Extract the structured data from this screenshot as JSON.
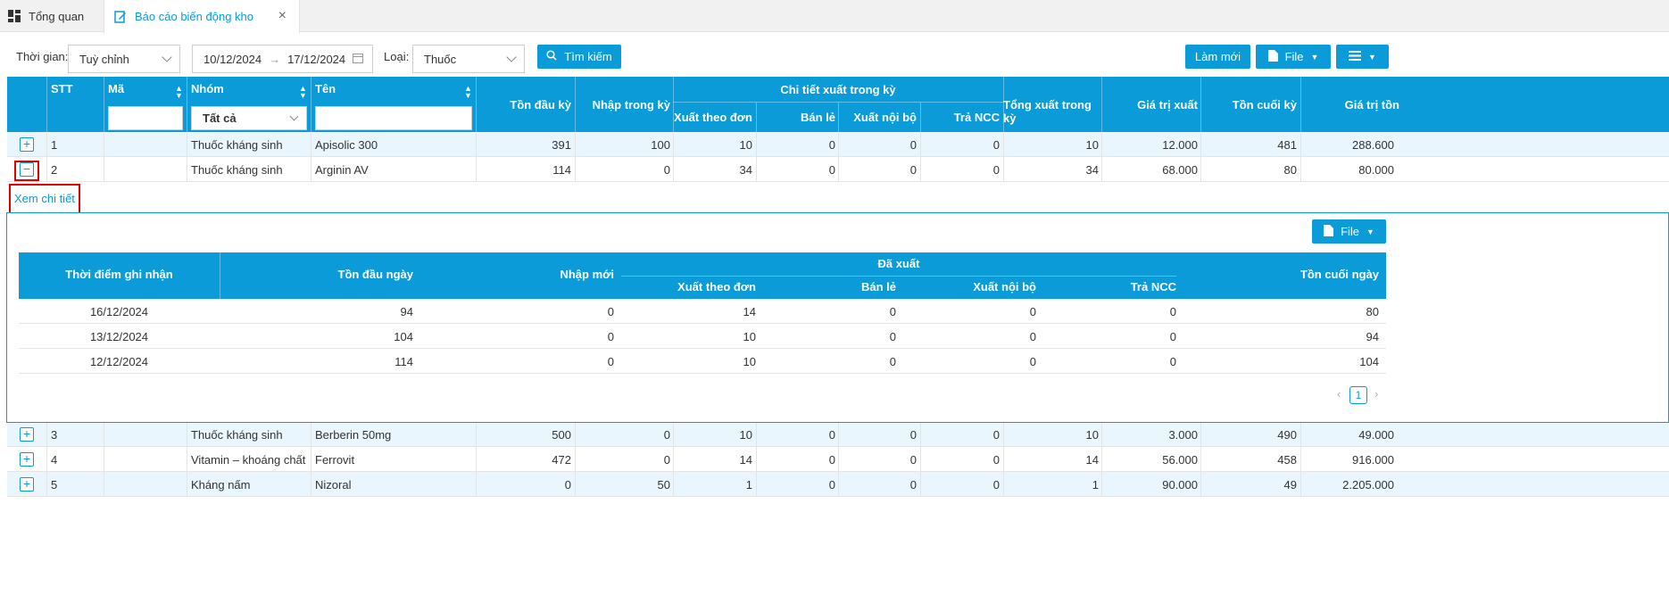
{
  "tabs": {
    "overview": "Tổng quan",
    "report": "Báo cáo biến động kho"
  },
  "filters": {
    "time_label": "Thời gian",
    "time_value": "Tuỳ chỉnh",
    "date_from": "10/12/2024",
    "date_to": "17/12/2024",
    "type_label": "Loại",
    "type_value": "Thuốc",
    "search_button": "Tìm kiếm",
    "refresh_button": "Làm mới",
    "file_button": "File"
  },
  "grid": {
    "headers": {
      "stt": "STT",
      "ma": "Mã",
      "nhom": "Nhóm",
      "ten": "Tên",
      "ton_dau": "Tồn đầu kỳ",
      "nhap": "Nhập trong kỳ",
      "chi_tiet": "Chi tiết xuất trong kỳ",
      "xuat_don": "Xuất theo đơn",
      "ban_le": "Bán lẻ",
      "xuat_noi_bo": "Xuất nội bộ",
      "tra_ncc": "Trả NCC",
      "tong_xuat": "Tổng xuất trong kỳ",
      "gia_tri_xuat": "Giá trị xuất",
      "ton_cuoi": "Tồn cuối kỳ",
      "gia_tri_ton": "Giá trị tồn"
    },
    "group_filter": "Tất cả",
    "rows": [
      {
        "stt": "1",
        "nhom": "Thuốc kháng sinh",
        "ten": "Apisolic 300",
        "ton_dau": "391",
        "nhap": "100",
        "xuat_don": "10",
        "ban_le": "0",
        "xuat_noi_bo": "0",
        "tra_ncc": "0",
        "tong_xuat": "10",
        "gia_tri_xuat": "12.000",
        "ton_cuoi": "481",
        "gia_tri_ton": "288.600"
      },
      {
        "stt": "2",
        "nhom": "Thuốc kháng sinh",
        "ten": "Arginin AV",
        "ton_dau": "114",
        "nhap": "0",
        "xuat_don": "34",
        "ban_le": "0",
        "xuat_noi_bo": "0",
        "tra_ncc": "0",
        "tong_xuat": "34",
        "gia_tri_xuat": "68.000",
        "ton_cuoi": "80",
        "gia_tri_ton": "80.000"
      },
      {
        "stt": "3",
        "nhom": "Thuốc kháng sinh",
        "ten": "Berberin 50mg",
        "ton_dau": "500",
        "nhap": "0",
        "xuat_don": "10",
        "ban_le": "0",
        "xuat_noi_bo": "0",
        "tra_ncc": "0",
        "tong_xuat": "10",
        "gia_tri_xuat": "3.000",
        "ton_cuoi": "490",
        "gia_tri_ton": "49.000"
      },
      {
        "stt": "4",
        "nhom": "Vitamin – khoáng chất",
        "ten": "Ferrovit",
        "ton_dau": "472",
        "nhap": "0",
        "xuat_don": "14",
        "ban_le": "0",
        "xuat_noi_bo": "0",
        "tra_ncc": "0",
        "tong_xuat": "14",
        "gia_tri_xuat": "56.000",
        "ton_cuoi": "458",
        "gia_tri_ton": "916.000"
      },
      {
        "stt": "5",
        "nhom": "Kháng nấm",
        "ten": "Nizoral",
        "ton_dau": "0",
        "nhap": "50",
        "xuat_don": "1",
        "ban_le": "0",
        "xuat_noi_bo": "0",
        "tra_ncc": "0",
        "tong_xuat": "1",
        "gia_tri_xuat": "90.000",
        "ton_cuoi": "49",
        "gia_tri_ton": "2.205.000"
      }
    ]
  },
  "detail": {
    "link": "Xem chi tiết",
    "file_button": "File",
    "headers": {
      "thoi_diem": "Thời điểm ghi nhận",
      "ton_dau_ngay": "Tồn đầu ngày",
      "nhap_moi": "Nhập mới",
      "da_xuat": "Đã xuất",
      "xuat_don": "Xuất theo đơn",
      "ban_le": "Bán lẻ",
      "xuat_noi_bo": "Xuất nội bộ",
      "tra_ncc": "Trả NCC",
      "ton_cuoi_ngay": "Tồn cuối ngày"
    },
    "rows": [
      {
        "date": "16/12/2024",
        "ton_dau": "94",
        "nhap": "0",
        "xuat_don": "14",
        "ban_le": "0",
        "xuat_noi_bo": "0",
        "tra_ncc": "0",
        "ton_cuoi": "80"
      },
      {
        "date": "13/12/2024",
        "ton_dau": "104",
        "nhap": "0",
        "xuat_don": "10",
        "ban_le": "0",
        "xuat_noi_bo": "0",
        "tra_ncc": "0",
        "ton_cuoi": "94"
      },
      {
        "date": "12/12/2024",
        "ton_dau": "114",
        "nhap": "0",
        "xuat_don": "10",
        "ban_le": "0",
        "xuat_noi_bo": "0",
        "tra_ncc": "0",
        "ton_cuoi": "104"
      }
    ],
    "page": "1"
  }
}
